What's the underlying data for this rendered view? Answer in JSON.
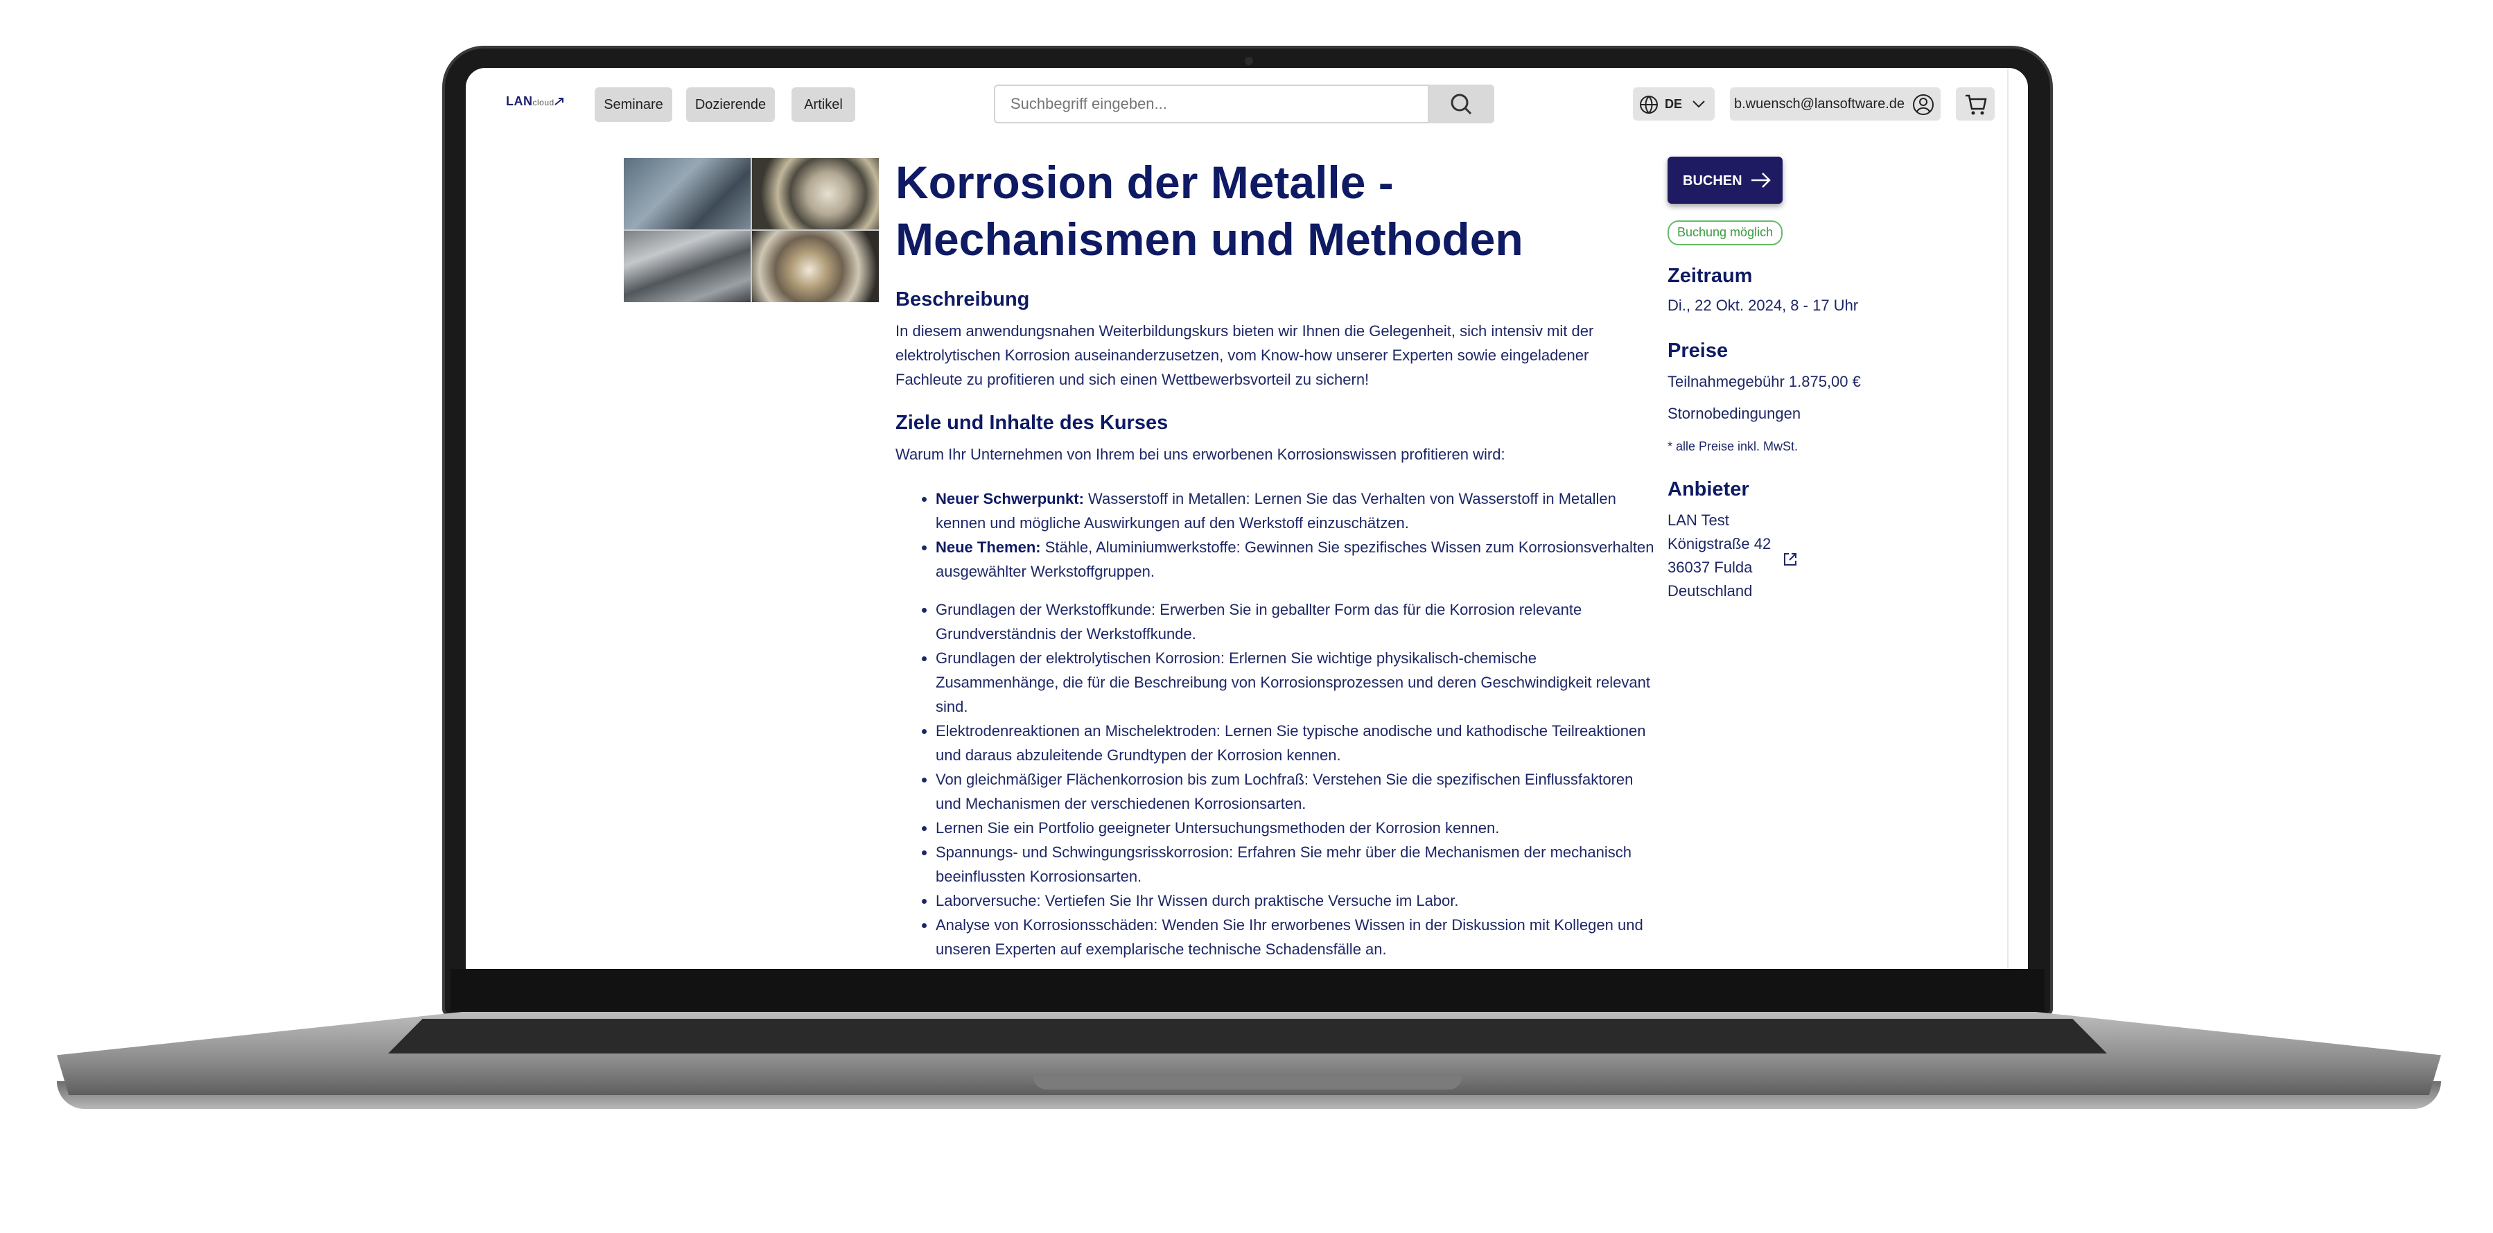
{
  "header": {
    "logo_text": "LAN",
    "logo_sub": "cloud",
    "nav": [
      "Seminare",
      "Dozierende",
      "Artikel"
    ],
    "search_placeholder": "Suchbegriff eingeben...",
    "lang": "DE",
    "user_email": "b.wuensch@lansoftware.de"
  },
  "course": {
    "title": "Korrosion der Metalle - Mechanismen und Methoden",
    "desc_heading": "Beschreibung",
    "desc_text": "In diesem anwendungsnahen Weiterbildungskurs bieten wir Ihnen die Gelegenheit, sich intensiv mit der elektrolytischen Korrosion auseinanderzusetzen, vom Know-how unserer Experten sowie eingeladener Fachleute zu profitieren und sich einen Wettbewerbsvorteil zu sichern!",
    "goals_heading": "Ziele und Inhalte des Kurses",
    "goals_intro": "Warum Ihr Unternehmen von Ihrem bei uns erworbenen Korrosionswissen profitieren wird:",
    "highlights": [
      {
        "bold": "Neuer Schwerpunkt:",
        "text": " Wasserstoff in Metallen: Lernen Sie das Verhalten von Wasserstoff in Metallen kennen und mögliche Auswirkungen auf den Werkstoff einzuschätzen."
      },
      {
        "bold": "Neue Themen:",
        "text": " Stähle, Aluminiumwerkstoffe: Gewinnen Sie spezifisches Wissen zum Korrosionsverhalten ausgewählter Werkstoffgruppen."
      }
    ],
    "items": [
      "Grundlagen der Werkstoffkunde: Erwerben Sie in geballter Form das für die Korrosion relevante Grundverständnis der Werkstoffkunde.",
      "Grundlagen der elektrolytischen Korrosion: Erlernen Sie wichtige physikalisch-chemische Zusammenhänge, die für die Beschreibung von Korrosionsprozessen und deren Geschwindigkeit relevant sind.",
      "Elektrodenreaktionen an Mischelektroden: Lernen Sie typische anodische und kathodische Teilreaktionen und daraus abzuleitende Grundtypen der Korrosion kennen.",
      "Von gleichmäßiger Flächenkorrosion bis zum Lochfraß: Verstehen Sie die spezifischen Einflussfaktoren und Mechanismen der verschiedenen Korrosionsarten.",
      "Lernen Sie ein Portfolio geeigneter Untersuchungsmethoden der Korrosion kennen.",
      "Spannungs- und Schwingungsrisskorrosion: Erfahren Sie mehr über die Mechanismen der mechanisch beeinflussten Korrosionsarten.",
      "Laborversuche: Vertiefen Sie Ihr Wissen durch praktische Versuche im Labor.",
      "Analyse von Korrosionsschäden: Wenden Sie Ihr erworbenes Wissen in der Diskussion mit Kollegen und unseren Experten auf exemplarische technische Schadensfälle an."
    ]
  },
  "sidebar": {
    "book_label": "BUCHEN",
    "badge": "Buchung möglich",
    "period_heading": "Zeitraum",
    "period": "Di., 22 Okt. 2024, 8 - 17 Uhr",
    "prices_heading": "Preise",
    "fee": "Teilnahmegebühr 1.875,00 €",
    "cancel": "Stornobedingungen",
    "vat_note": "* alle Preise inkl. MwSt.",
    "provider_heading": "Anbieter",
    "provider": [
      "LAN Test",
      "Königstraße 42",
      "36037 Fulda",
      "Deutschland"
    ]
  }
}
